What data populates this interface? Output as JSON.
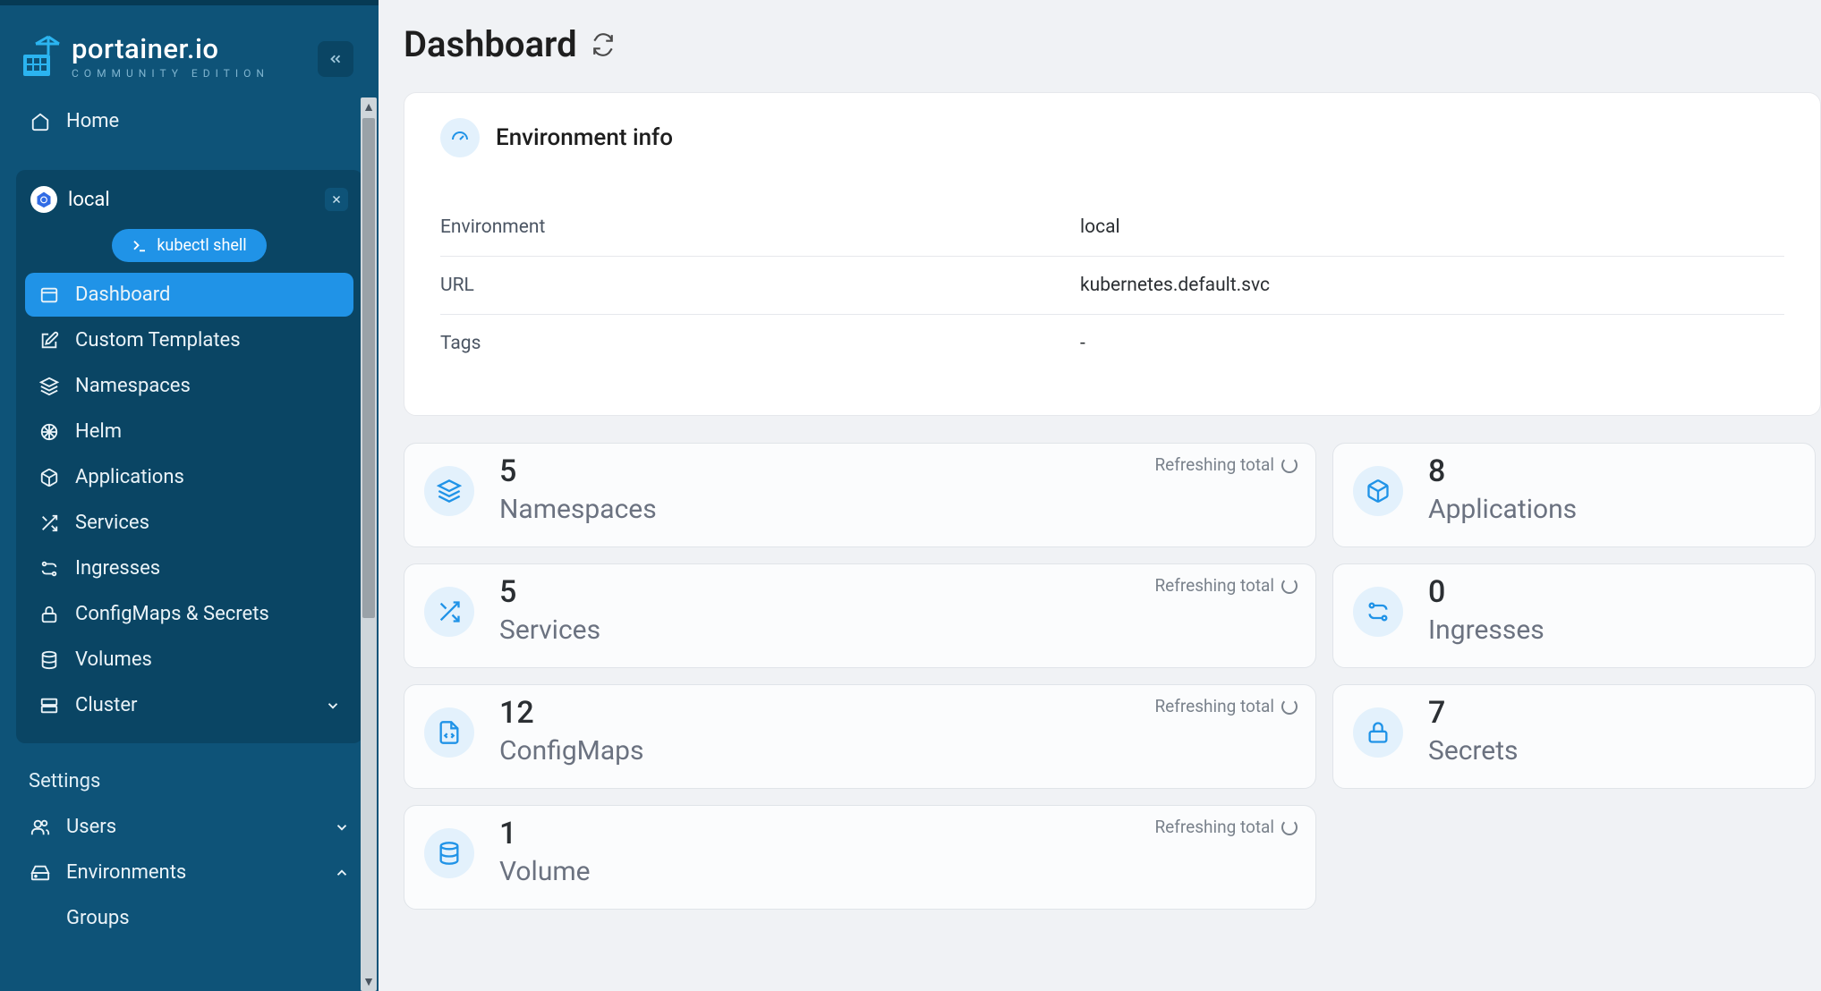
{
  "brand": {
    "name": "portainer.io",
    "edition": "COMMUNITY EDITION"
  },
  "sidebar": {
    "home": "Home",
    "environment": {
      "name": "local",
      "shell": "kubectl shell"
    },
    "items": [
      {
        "label": "Dashboard"
      },
      {
        "label": "Custom Templates"
      },
      {
        "label": "Namespaces"
      },
      {
        "label": "Helm"
      },
      {
        "label": "Applications"
      },
      {
        "label": "Services"
      },
      {
        "label": "Ingresses"
      },
      {
        "label": "ConfigMaps & Secrets"
      },
      {
        "label": "Volumes"
      },
      {
        "label": "Cluster"
      }
    ],
    "settings_heading": "Settings",
    "settings_items": [
      {
        "label": "Users"
      },
      {
        "label": "Environments"
      }
    ],
    "env_sub": "Groups"
  },
  "page": {
    "title": "Dashboard"
  },
  "env_info": {
    "heading": "Environment info",
    "rows": [
      {
        "label": "Environment",
        "value": "local"
      },
      {
        "label": "URL",
        "value": "kubernetes.default.svc"
      },
      {
        "label": "Tags",
        "value": "-"
      }
    ]
  },
  "refreshing_text": "Refreshing total",
  "cards": {
    "namespaces": {
      "count": "5",
      "label": "Namespaces"
    },
    "applications": {
      "count": "8",
      "label": "Applications"
    },
    "services": {
      "count": "5",
      "label": "Services"
    },
    "ingresses": {
      "count": "0",
      "label": "Ingresses"
    },
    "configmaps": {
      "count": "12",
      "label": "ConfigMaps"
    },
    "secrets": {
      "count": "7",
      "label": "Secrets"
    },
    "volumes": {
      "count": "1",
      "label": "Volume"
    }
  }
}
